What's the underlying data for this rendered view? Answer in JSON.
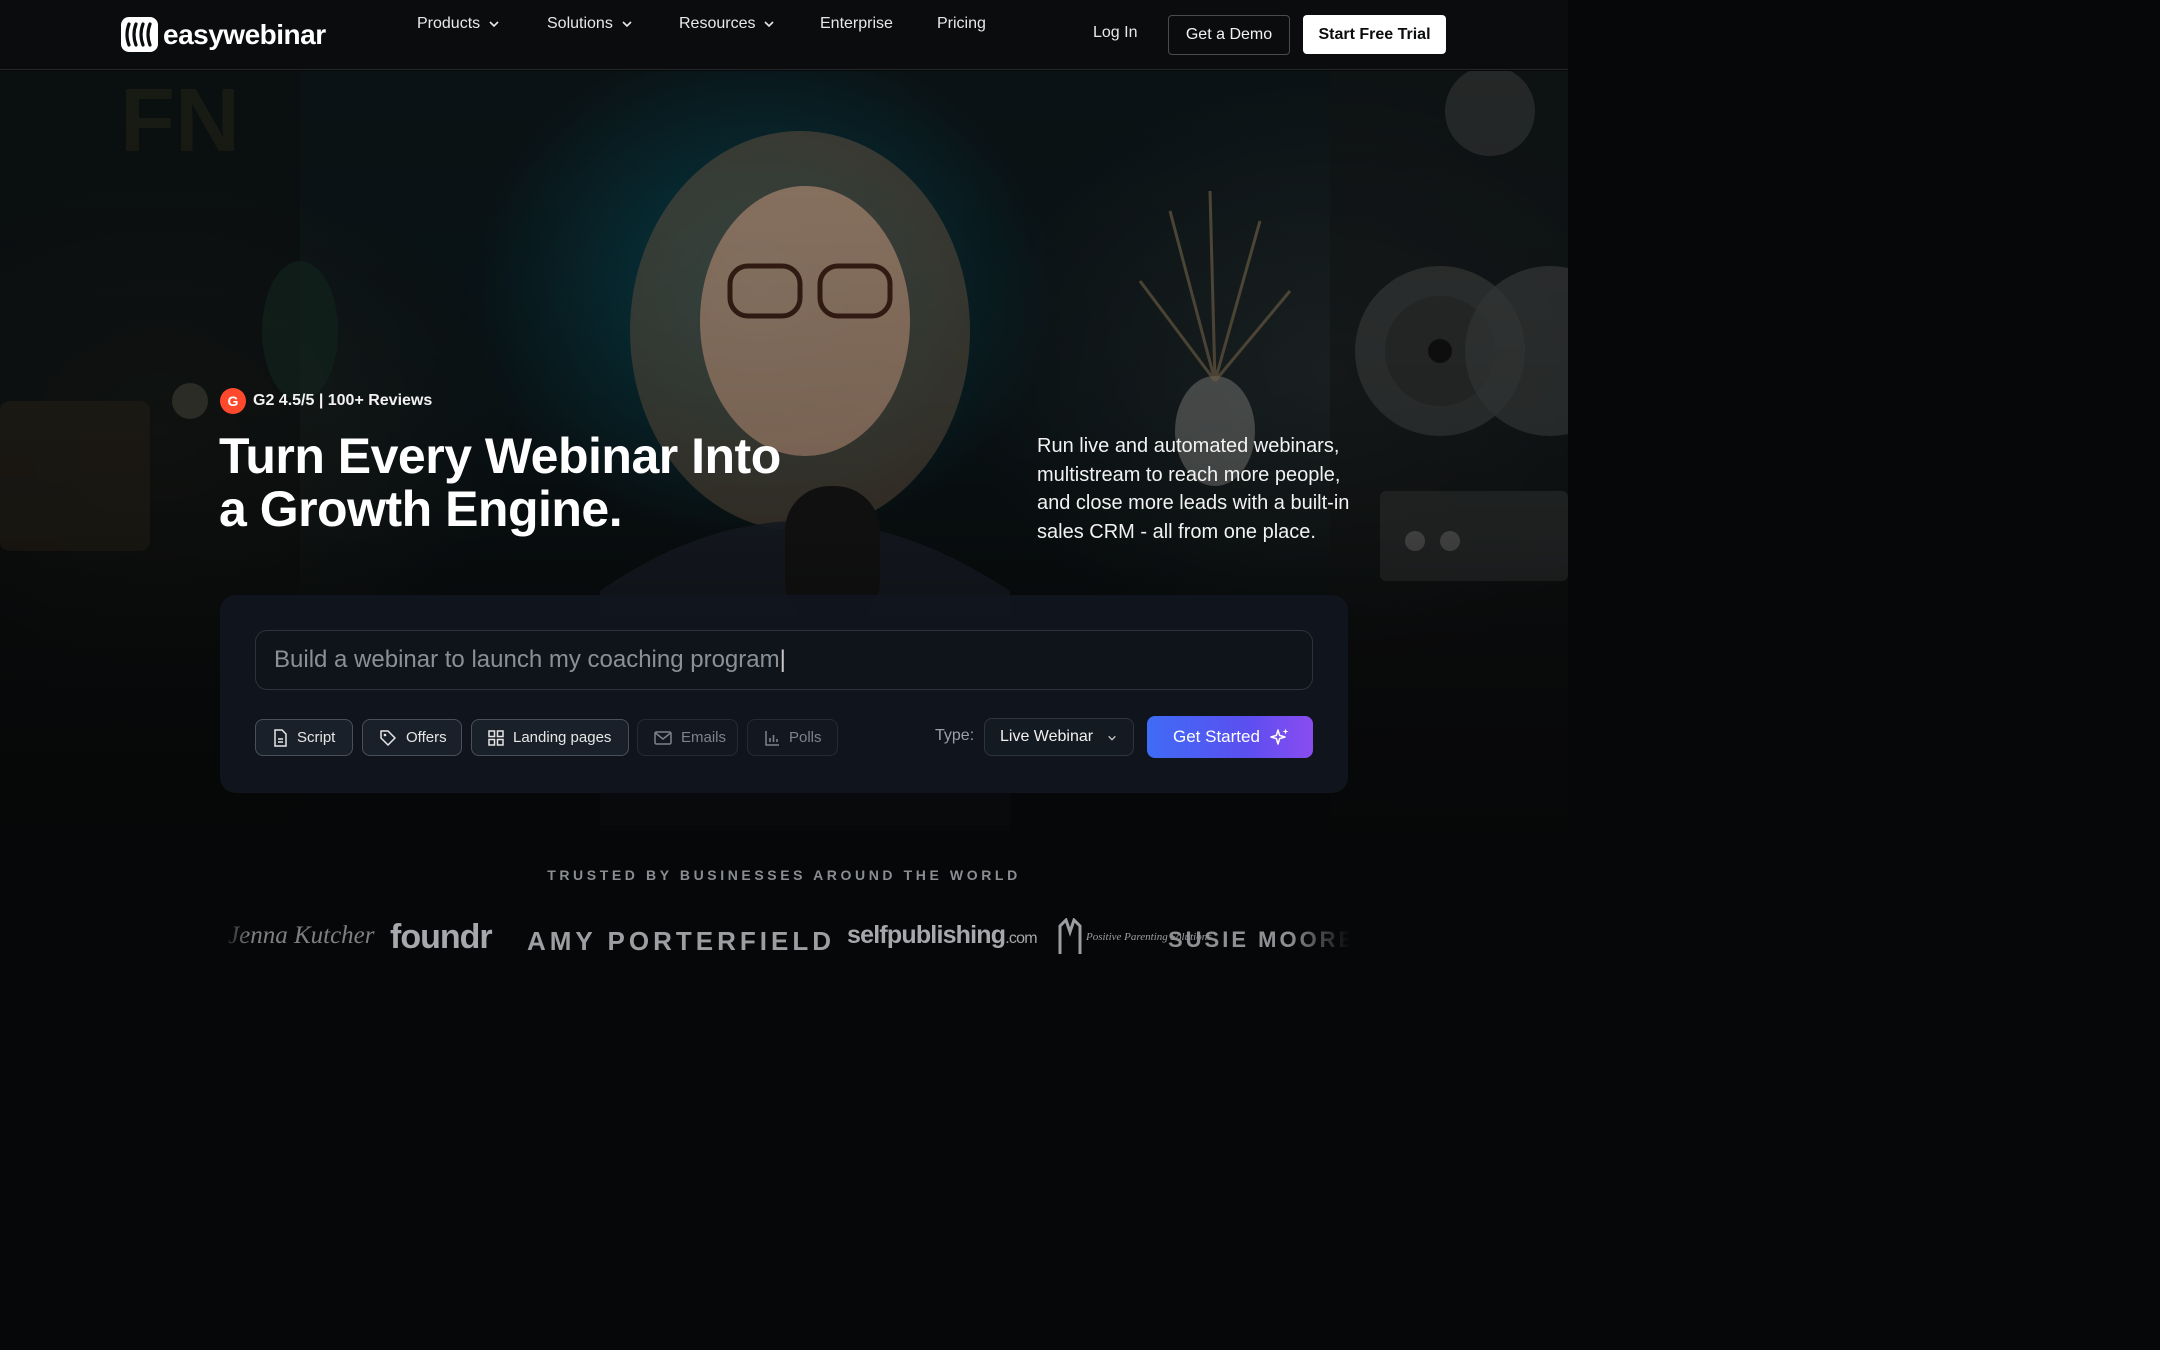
{
  "nav": {
    "brand": "easywebinar",
    "links": [
      {
        "label": "Products",
        "dropdown": true
      },
      {
        "label": "Solutions",
        "dropdown": true
      },
      {
        "label": "Resources",
        "dropdown": true
      },
      {
        "label": "Enterprise",
        "dropdown": false
      },
      {
        "label": "Pricing",
        "dropdown": false
      }
    ],
    "login": "Log In",
    "demo": "Get a Demo",
    "trial": "Start Free Trial"
  },
  "hero": {
    "rating_badge": "G",
    "rating": "G2 4.5/5 | 100+ Reviews",
    "headline_line1": "Turn Every Webinar Into",
    "headline_line2": "a Growth Engine.",
    "subcopy": "Run live and automated webinars, multistream to reach more people, and close more leads with a built-in sales CRM - all from one place."
  },
  "builder": {
    "prompt_value": "Build a webinar to launch my coaching program",
    "chips": [
      {
        "label": "Script",
        "icon": "document-icon",
        "active": true
      },
      {
        "label": "Offers",
        "icon": "tag-icon",
        "active": true
      },
      {
        "label": "Landing pages",
        "icon": "grid-icon",
        "active": true
      },
      {
        "label": "Emails",
        "icon": "mail-icon",
        "active": false
      },
      {
        "label": "Polls",
        "icon": "bar-chart-icon",
        "active": false
      }
    ],
    "type_label": "Type:",
    "type_value": "Live Webinar",
    "cta": "Get Started",
    "cta_icon": "sparkles-icon"
  },
  "trusted": {
    "heading": "TRUSTED BY BUSINESSES AROUND THE WORLD",
    "logos": [
      "Jenna Kutcher",
      "foundr",
      "AMY PORTERFIELD",
      "selfpublishing",
      ".com",
      "Positive Parenting Solutions",
      "SUSIE MOORE"
    ]
  },
  "colors": {
    "cta_gradient_start": "#3f6cf6",
    "cta_gradient_end": "#8a4cf0",
    "g2_red": "#ff492c"
  }
}
